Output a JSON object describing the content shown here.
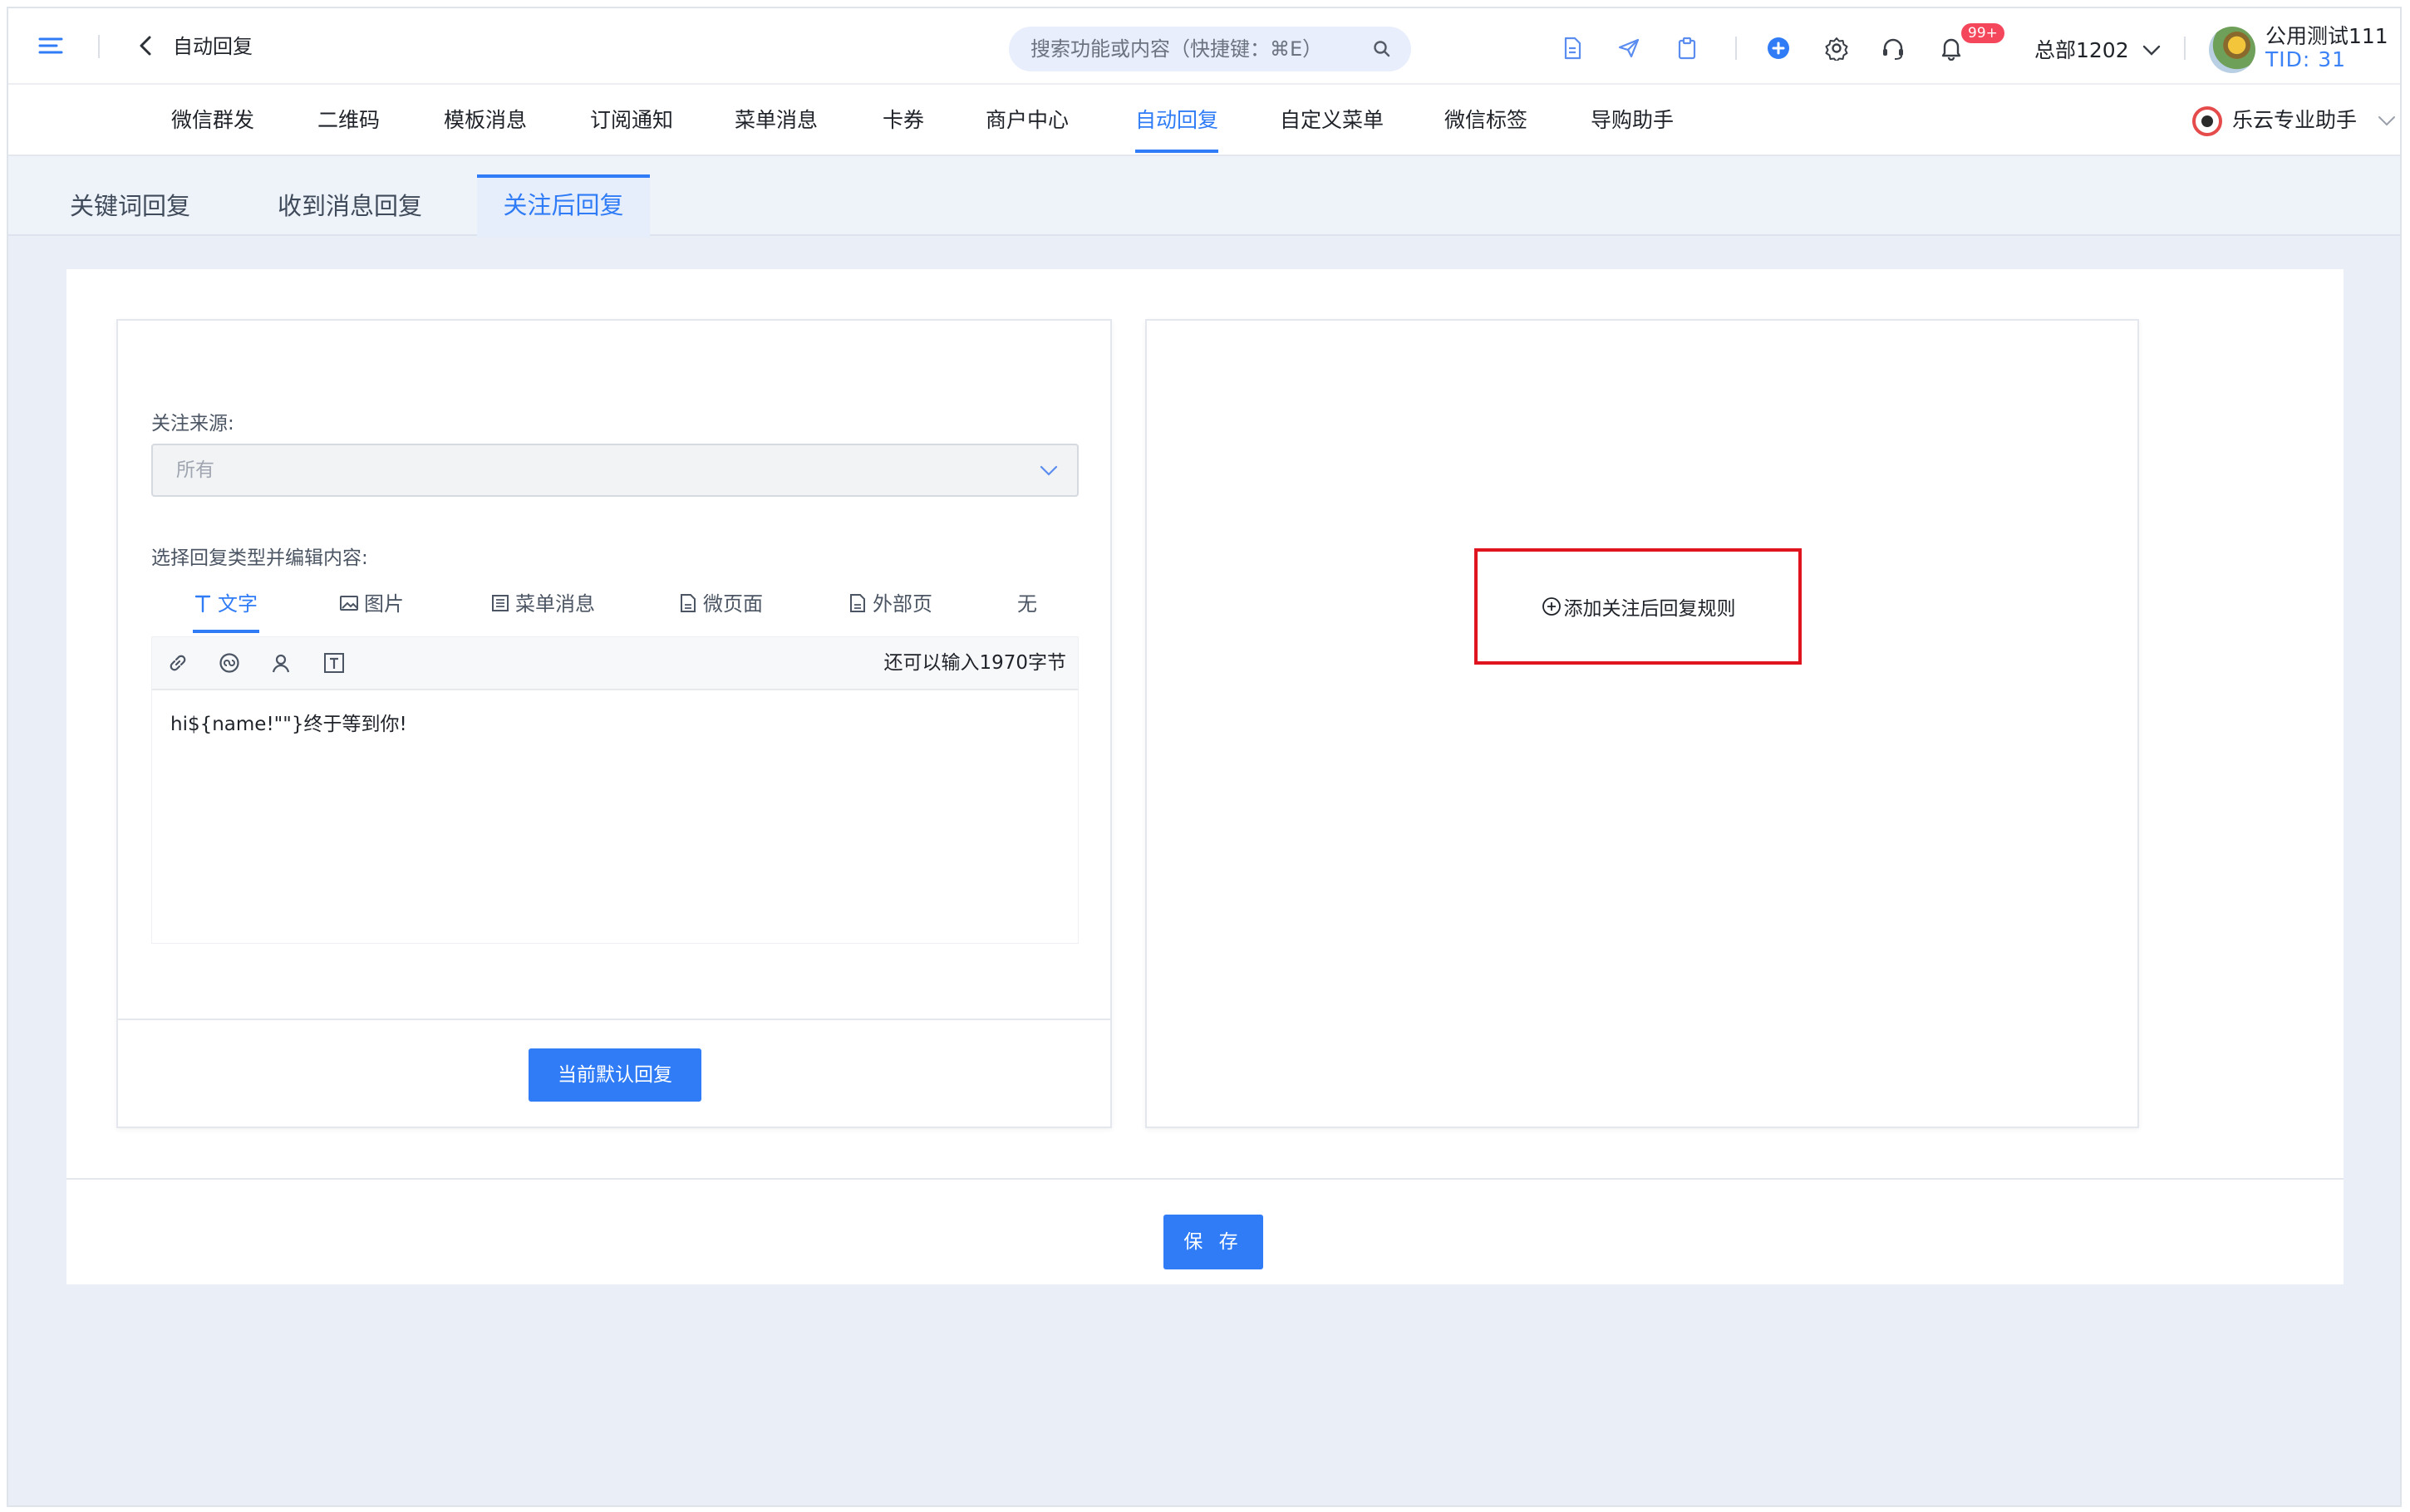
{
  "header": {
    "title": "自动回复",
    "search_placeholder": "搜索功能或内容（快捷键：⌘E）",
    "notification_badge": "99+",
    "org": "总部1202",
    "user": {
      "name": "公用测试111",
      "tid": "TID: 31"
    }
  },
  "nav": {
    "items": [
      {
        "label": "微信群发"
      },
      {
        "label": "二维码"
      },
      {
        "label": "模板消息"
      },
      {
        "label": "订阅通知"
      },
      {
        "label": "菜单消息"
      },
      {
        "label": "卡券"
      },
      {
        "label": "商户中心"
      },
      {
        "label": "自动回复",
        "active": true
      },
      {
        "label": "自定义菜单"
      },
      {
        "label": "微信标签"
      },
      {
        "label": "导购助手"
      }
    ],
    "assistant": "乐云专业助手"
  },
  "subtabs": {
    "keyword": "关键词回复",
    "message": "收到消息回复",
    "follow": "关注后回复"
  },
  "form": {
    "source_label": "关注来源:",
    "source_value": "所有",
    "type_label": "选择回复类型并编辑内容:",
    "types": [
      {
        "label": "文字",
        "icon": "text-icon",
        "active": true
      },
      {
        "label": "图片",
        "icon": "image-icon"
      },
      {
        "label": "菜单消息",
        "icon": "menu-message-icon"
      },
      {
        "label": "微页面",
        "icon": "micro-page-icon"
      },
      {
        "label": "外部页",
        "icon": "external-page-icon"
      },
      {
        "label": "无",
        "icon": ""
      }
    ],
    "remaining": "还可以输入1970字节",
    "content": "hi${name!\"\"}终于等到你!",
    "default_button": "当前默认回复"
  },
  "rules": {
    "add_label": "添加关注后回复规则"
  },
  "footer": {
    "save_label": "保 存"
  },
  "colors": {
    "accent": "#2f7cf6",
    "highlight_box": "#e0141e",
    "badge": "#f5475b"
  }
}
